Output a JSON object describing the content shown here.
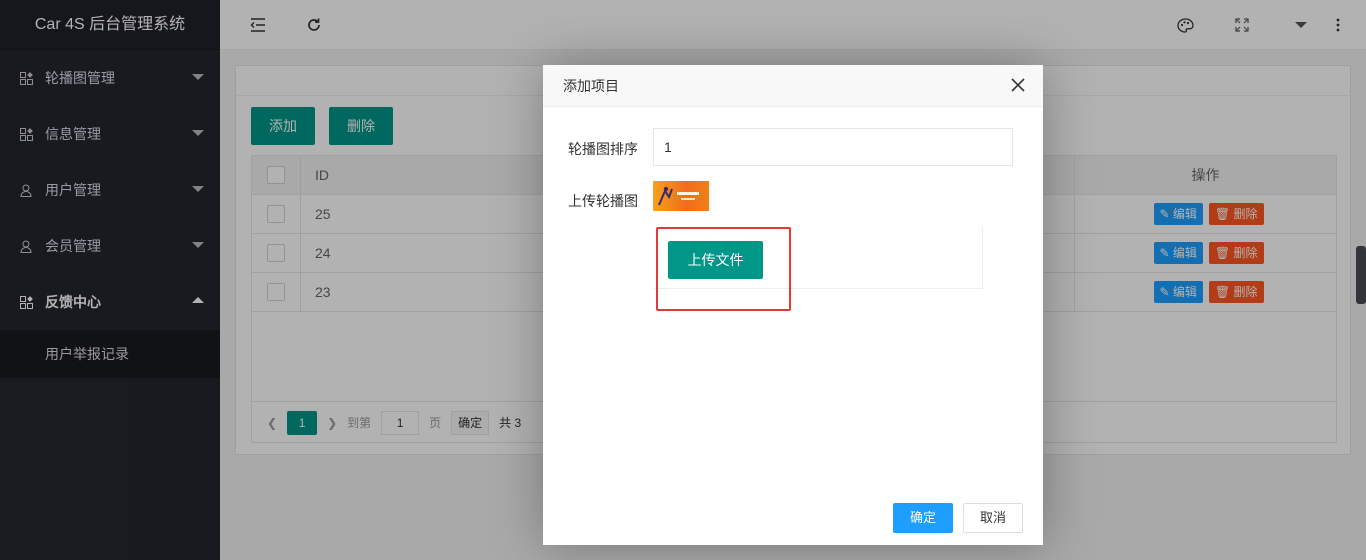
{
  "app": {
    "title": "Car 4S 后台管理系统"
  },
  "sidebar": {
    "items": [
      {
        "label": "轮播图管理"
      },
      {
        "label": "信息管理"
      },
      {
        "label": "用户管理"
      },
      {
        "label": "会员管理"
      },
      {
        "label": "反馈中心"
      }
    ],
    "subitems": [
      {
        "label": "用户举报记录"
      }
    ]
  },
  "toolbar": {
    "add_label": "添加",
    "delete_label": "删除"
  },
  "table": {
    "headers": {
      "id": "ID",
      "actions": "操作"
    },
    "rows": [
      {
        "id": "25"
      },
      {
        "id": "24"
      },
      {
        "id": "23"
      }
    ],
    "edit_label": "编辑",
    "delete_label": "删除"
  },
  "pager": {
    "current": "1",
    "goto_label": "到第",
    "page_input": "1",
    "page_unit": "页",
    "confirm_label": "确定",
    "total_text": "共 3"
  },
  "modal": {
    "title": "添加项目",
    "fields": {
      "sort_label": "轮播图排序",
      "sort_value": "1",
      "image_label": "上传轮播图"
    },
    "upload_label": "上传文件",
    "ok_label": "确定",
    "cancel_label": "取消"
  },
  "colors": {
    "sidebar": "#23262e",
    "primary": "#009688",
    "blue": "#1e9fff",
    "red": "#ff5722",
    "highlight": "#e53935"
  }
}
